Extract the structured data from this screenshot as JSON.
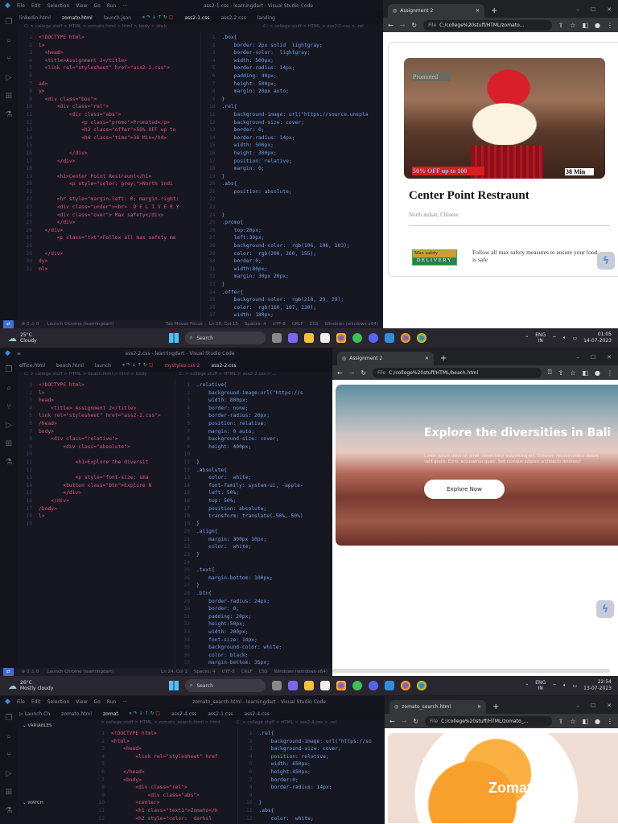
{
  "panel1": {
    "vscode": {
      "menu": [
        "File",
        "Edit",
        "Selection",
        "View",
        "Go",
        "Run",
        "···"
      ],
      "window_title": "ass2-1.css - learningdart - Visual Studio Code",
      "tabs": [
        "linkedin.html",
        "zomato.html",
        "launch.json",
        "ass2-1.css",
        "ass2-2.css",
        "landing"
      ],
      "breadcrumb_left": "C: > college stuff > HTML > zomato.html > html > body > div.b",
      "breadcrumb_right": "C: > college stuff > HTML > ass2-1.css > .rel",
      "html_lines": [
        "<!DOCTYPE html>",
        "l>",
        "  <head>",
        "  <title>Assignment 2</title>",
        "  <link rel=\"stylesheet\" href=\"ass2-1.css\">",
        "",
        "ad>",
        "y>",
        "  <div class=\"box\">",
        "      <div class=\"rel\">",
        "          <div class=\"abs\">",
        "              <p class=\"promo\">Promoted</p>",
        "              <h3 class=\"offer\">50% OFF up to",
        "              <h4 class=\"time\">38 Min</h4>",
        "",
        "          </div>",
        "      </div>",
        "",
        "      <h1>Center Point Restraunt</h1>",
        "          <p style=\"color: grey;\">North indi",
        "",
        "      <hr style=\"margin-left: 0; margin-right:",
        "      <div class=\"under\"><br>  D E L I V E R Y",
        "      <div class=\"over\"> Max safety</div>",
        "      </div>",
        "  </div>",
        "      <p class=\"txt\">Follow all max safety me",
        "",
        "  </div>",
        "dy>",
        "ml>"
      ],
      "css_lines": [
        ".box{",
        "    border: 2px solid  lightgray;",
        "    border-color:  lightgray;",
        "    width: 500px;",
        "    border-radius: 14px;",
        "    padding: 40px;",
        "    height: 500px;",
        "    margin: 20px auto;",
        "}",
        ".rel{",
        "    background-image: url(\"https://source.unspla",
        "    background-size: cover;",
        "    border: 0;",
        "    border-radius: 14px;",
        "    width: 500px;",
        "    height: 300px;",
        "    position: relative;",
        "    margin: 0;",
        "}",
        ".abs{",
        "    position: absolute;",
        "",
        "",
        "}",
        ".promo{",
        "    top:20px;",
        "    left:30px;",
        "    background-color:  rgb(106, 106, 103);",
        "    color:  rgb(200, 200, 155);",
        "    border:0;",
        "    width:80px;",
        "    margin: 30px 20px;",
        "}",
        ".offer{",
        "    background-color:  rgb(218, 29, 29);",
        "    color:  rgb(160, 187, 230);",
        "    width: 180px;"
      ],
      "status": {
        "errors": "⊗ 0 ⚠ 0",
        "launch": "Launch Chrome (learningdart)",
        "focus": "Tab Moves Focus",
        "position": "Ln 55, Col 15",
        "spaces": "Spaces: 4",
        "encoding": "UTF-8",
        "eol": "CRLF",
        "lang": "CSS",
        "platform": "Windows (windows-x64)"
      }
    },
    "browser": {
      "tab_title": "Assignment 2",
      "url": "C:/college%20stuff/HTML/zomato...",
      "url_prefix": "File",
      "promo": "Promoted",
      "offer": "50% OFF up to 100",
      "time": "38 Min",
      "restaurant": "Center Point Restraunt",
      "cuisine": "North indian, Chinese",
      "safety_top": "Max safety",
      "safety_bottom": "DELIVERY",
      "safety_text": "Follow all max safety measures to ensure your food is safe"
    },
    "taskbar": {
      "temp": "25°C",
      "weather": "Cloudy",
      "search": "Search",
      "lang": "ENG",
      "region": "IN",
      "time": "01:05",
      "date": "14-07-2023"
    }
  },
  "panel2": {
    "vscode": {
      "window_title": "ass2-2.css - learningdart - Visual Studio Code",
      "tabs": [
        "office.html",
        "beach.html",
        "launch",
        "mystyles.css 2",
        "ass2-2.css"
      ],
      "breadcrumb_left": "C: > college stuff > HTML > beach.html > html > body",
      "breadcrumb_right": "C: > college stuff > HTML > ass2-2.css > ...",
      "html_lines": [
        "<!DOCTYPE html>",
        "l>",
        "head>",
        "    <title> Assignment 2</title>",
        "link rel=\"stylesheet\" href=\"ass2-2.css\">",
        "/head>",
        "body>",
        "    <div class=\"relative\">",
        "        <div class=\"absolute\">",
        "",
        "            <h1>Explore the diversit",
        "",
        "            <p style=\"font-size: sma",
        "        <button class=\"btn\">Explore N",
        "        </div>",
        "    </div>",
        "/body>",
        "l>",
        ""
      ],
      "css_lines": [
        ".relative{",
        "    background-image:url(\"https://s",
        "    width: 800px;",
        "    border: none;",
        "    border-radius: 20px;",
        "    position: relative;",
        "    margin: 0 auto;",
        "    background-size: cover;",
        "    height: 400px;",
        "",
        "}",
        ".absolute{",
        "    color:  white;",
        "    font-family: system-ui, -apple-",
        "    left: 50%;",
        "    top: 50%;",
        "    position: absolute;",
        "    transform: translate(-50%,-50%)",
        "}",
        ".align{",
        "    margin: 300px 10px;",
        "    color:  white;",
        "}",
        "",
        ".text{",
        "    margin-bottom: 100px;",
        "}",
        ".btn{",
        "    border-radius: 24px;",
        "    border: 0;",
        "    padding: 20px;",
        "    height:50px;",
        "    width: 200px;",
        "    font-size: 14px;",
        "    background-color: white;",
        "    color: black;",
        "    margin-bottom: 35px;"
      ],
      "status": {
        "errors": "⊗ 0 ⚠ 0",
        "launch": "Launch Chrome (learningdart)",
        "position": "Ln 24, Col 1",
        "spaces": "Spaces: 4",
        "encoding": "UTF-8",
        "eol": "CRLF",
        "lang": "CSS",
        "platform": "Windows (windows-x64)"
      }
    },
    "browser": {
      "tab_title": "Assignment 2",
      "url": "C:/college%20stuff/HTML/beach.html",
      "url_prefix": "File",
      "heading": "Explore the diversities in Bali",
      "paragraph": "Lorem ipsum dolor sit amet consectetur adipisicing elit. Dolorem necessitatibus dolore velit gratis. Enim, accusamus quasi. Sed cumque adipisci architecto dolorem?",
      "button": "Explore Now"
    },
    "taskbar": {
      "temp": "26°C",
      "weather": "Mostly cloudy",
      "search": "Search",
      "lang": "ENG",
      "region": "IN",
      "time": "22:54",
      "date": "13-07-2023"
    }
  },
  "panel3": {
    "vscode": {
      "menu": [
        "File",
        "Edit",
        "Selection",
        "View",
        "Go",
        "Run",
        "···"
      ],
      "window_title": "zomato_search.html - learningdart - Visual Studio Code",
      "launch": "Launch Ch",
      "tabs": [
        "zomato.html",
        "zomat",
        "ass2-4.css",
        "ass2-1.css",
        "ass2-4.css"
      ],
      "variables": "VARIABLES",
      "watch": "WATCH",
      "breadcrumb_left": "C: > college stuff > HTML > zomato_search.html > html",
      "breadcrumb_right": "C: > college stuff > HTML > ass2-4.css > .rel",
      "html_lines": [
        "<!DOCTYPE html>",
        "<html>",
        "    <head>",
        "        <link rel=\"stylesheet\" href",
        "",
        "    </head>",
        "    <body>",
        "        <div class=\"rel\">",
        "            <div class=\"abs\">",
        "        <center>",
        "        <h1 class=\"text1\">Zomato</h",
        "        <h2 style=\"color:  darksl"
      ],
      "css_lines": [
        ".rel{",
        "    background-image: url(\"https://so",
        "    background-size: cover;",
        "    position: relative;",
        "    width: 650px;",
        "    height:450px;",
        "    border:0;",
        "    border-radius: 14px;",
        "",
        "}",
        ".abs{",
        "    color:  white;"
      ]
    },
    "browser": {
      "tab_title": "zomato_search.html",
      "url": "C:/college%20stuff/HTML/zomato_...",
      "url_prefix": "File",
      "heading": "Zomato"
    }
  }
}
